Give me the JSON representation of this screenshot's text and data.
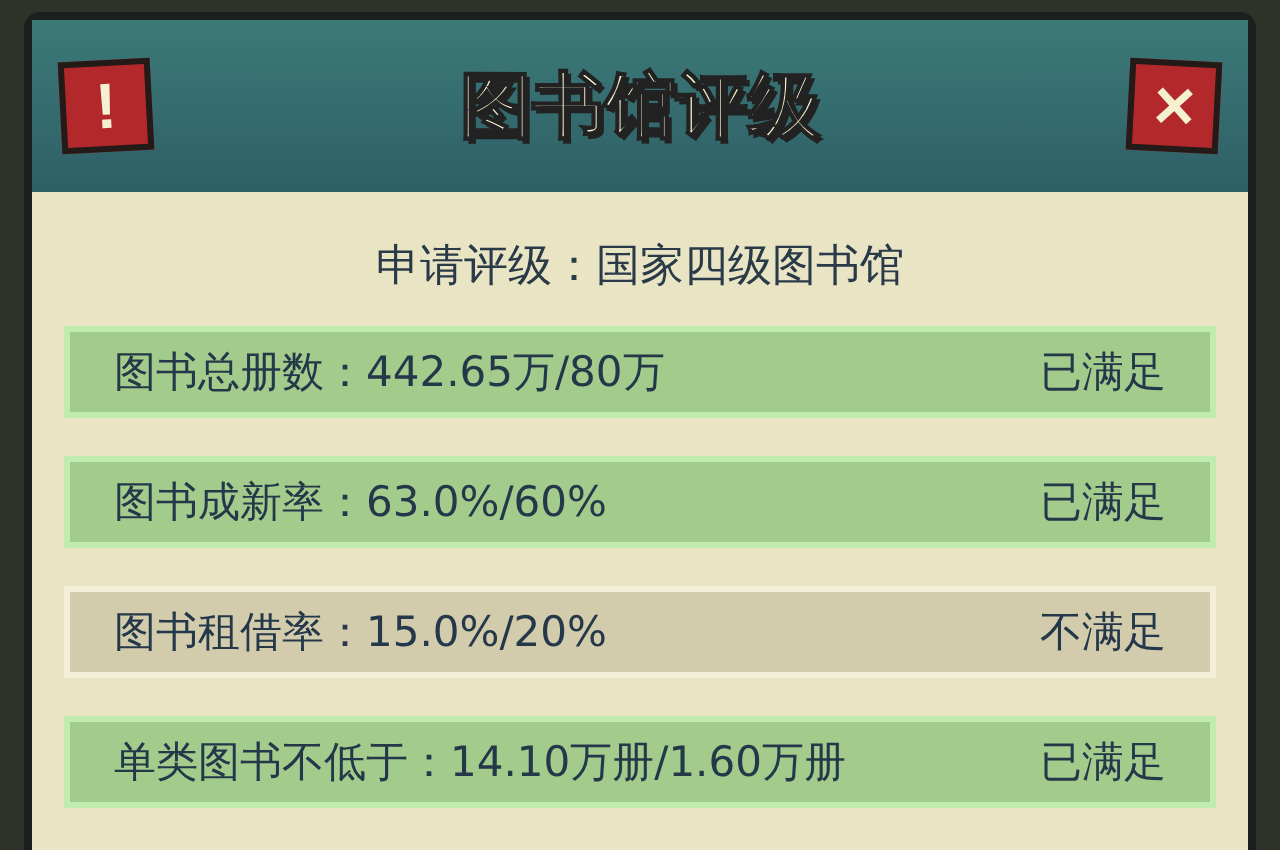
{
  "window": {
    "title": "图书馆评级",
    "info_button": "!",
    "close_button": "✕"
  },
  "application": {
    "label": "申请评级：",
    "value": "国家四级图书馆"
  },
  "requirements": [
    {
      "text": "图书总册数：442.65万/80万",
      "status": "已满足",
      "met": true
    },
    {
      "text": "图书成新率：63.0%/60%",
      "status": "已满足",
      "met": true
    },
    {
      "text": "图书租借率：15.0%/20%",
      "status": "不满足",
      "met": false
    },
    {
      "text": "单类图书不低于：14.10万册/1.60万册",
      "status": "已满足",
      "met": true
    }
  ]
}
